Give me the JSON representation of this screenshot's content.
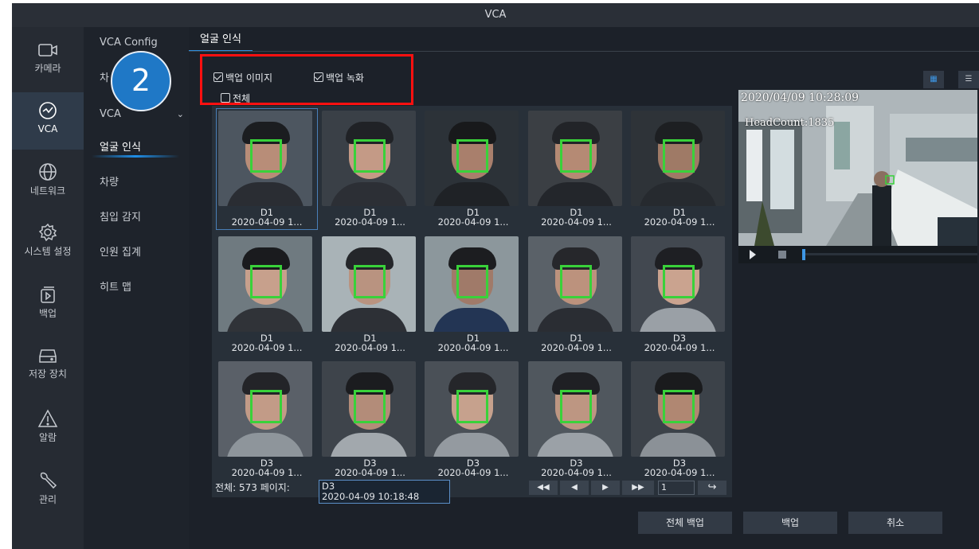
{
  "window": {
    "title": "VCA"
  },
  "iconbar": {
    "items": [
      {
        "label": "카메라",
        "icon": "camera-icon"
      },
      {
        "label": "VCA",
        "icon": "vca-icon"
      },
      {
        "label": "네트워크",
        "icon": "globe-icon"
      },
      {
        "label": "시스템 설정",
        "icon": "gear-icon"
      },
      {
        "label": "백업",
        "icon": "backup-icon"
      },
      {
        "label": "저장 장치",
        "icon": "storage-icon"
      },
      {
        "label": "알람",
        "icon": "alarm-icon"
      },
      {
        "label": "관리",
        "icon": "wrench-icon"
      }
    ]
  },
  "menu": {
    "items": [
      {
        "label": "VCA Config"
      },
      {
        "label": "차"
      },
      {
        "label": "VCA"
      },
      {
        "label": "얼굴 인식"
      },
      {
        "label": "차량"
      },
      {
        "label": "침입 감지"
      },
      {
        "label": "인원 집계"
      },
      {
        "label": "히트 맵"
      }
    ],
    "chevron": "⌄"
  },
  "annotation": {
    "step": "2"
  },
  "tab": {
    "label": "얼굴 인식"
  },
  "options": {
    "backup_image": {
      "label": "백업 이미지",
      "checked": true
    },
    "backup_video": {
      "label": "백업 녹화",
      "checked": true
    },
    "select_all": {
      "label": "전체",
      "checked": false
    }
  },
  "thumbnails": [
    {
      "channel": "D1",
      "time": "2020-04-09 1..."
    },
    {
      "channel": "D1",
      "time": "2020-04-09 1..."
    },
    {
      "channel": "D1",
      "time": "2020-04-09 1..."
    },
    {
      "channel": "D1",
      "time": "2020-04-09 1..."
    },
    {
      "channel": "D1",
      "time": "2020-04-09 1..."
    },
    {
      "channel": "D1",
      "time": "2020-04-09 1..."
    },
    {
      "channel": "D1",
      "time": "2020-04-09 1..."
    },
    {
      "channel": "D1",
      "time": "2020-04-09 1..."
    },
    {
      "channel": "D1",
      "time": "2020-04-09 1..."
    },
    {
      "channel": "D3",
      "time": "2020-04-09 1..."
    },
    {
      "channel": "D3",
      "time": "2020-04-09 1..."
    },
    {
      "channel": "D3",
      "time": "2020-04-09 1..."
    },
    {
      "channel": "D3",
      "time": "2020-04-09 1..."
    },
    {
      "channel": "D3",
      "time": "2020-04-09 1..."
    },
    {
      "channel": "D3",
      "time": "2020-04-09 1..."
    }
  ],
  "status": {
    "total_label": "전체:",
    "total": "573",
    "page_label": "페이지:"
  },
  "tooltip": {
    "channel": "D3",
    "time": "2020-04-09 10:18:48"
  },
  "pager": {
    "first": "◀◀",
    "prev": "◀",
    "next": "▶",
    "last": "▶▶",
    "page": "1",
    "go": "↪"
  },
  "preview": {
    "timestamp": "2020/04/09 10:28:09",
    "headcount": "HeadCount:1835"
  },
  "view_toggle": {
    "grid": "▦",
    "list": "☰"
  },
  "buttons": {
    "backup_all": "전체 백업",
    "backup": "백업",
    "cancel": "취소"
  },
  "colors": {
    "accent": "#1f8fe8",
    "highlight_box": "#ff1010",
    "face_box": "#39d23a",
    "badge": "#1f78c6"
  }
}
